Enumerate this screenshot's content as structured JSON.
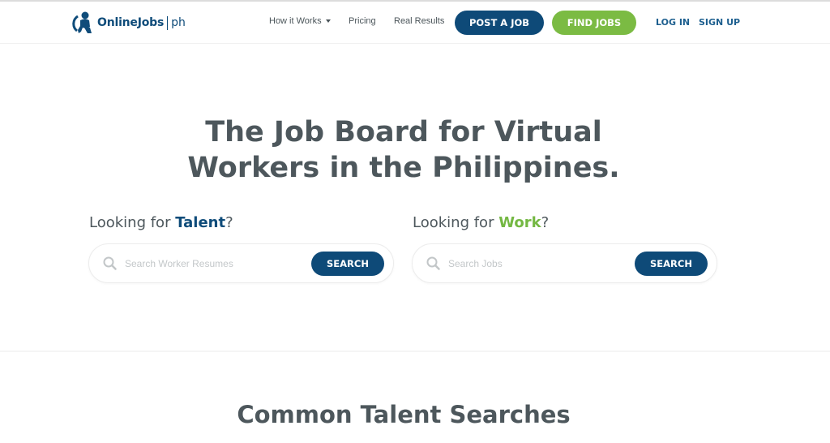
{
  "brand": {
    "name": "OnlineJobs",
    "suffix": "ph",
    "colors": {
      "primary": "#0e4a78",
      "accent": "#7bbb43",
      "text": "#4d575c"
    }
  },
  "nav": {
    "links": [
      {
        "label": "How it Works",
        "has_dropdown": true
      },
      {
        "label": "Pricing"
      },
      {
        "label": "Real Results"
      }
    ],
    "post_job": "POST A JOB",
    "find_jobs": "FIND JOBS",
    "login": "LOG IN",
    "signup": "SIGN UP"
  },
  "hero": {
    "title_line1": "The Job Board for Virtual",
    "title_line2": "Workers in the Philippines."
  },
  "talent_search": {
    "prefix": "Looking for ",
    "highlight": "Talent",
    "suffix": "?",
    "placeholder": "Search Worker Resumes",
    "value": "",
    "button": "SEARCH",
    "icon": "search-icon"
  },
  "work_search": {
    "prefix": "Looking for ",
    "highlight": "Work",
    "suffix": "?",
    "placeholder": "Search Jobs",
    "value": "",
    "button": "SEARCH",
    "icon": "search-icon"
  },
  "section": {
    "title": "Common Talent Searches"
  }
}
